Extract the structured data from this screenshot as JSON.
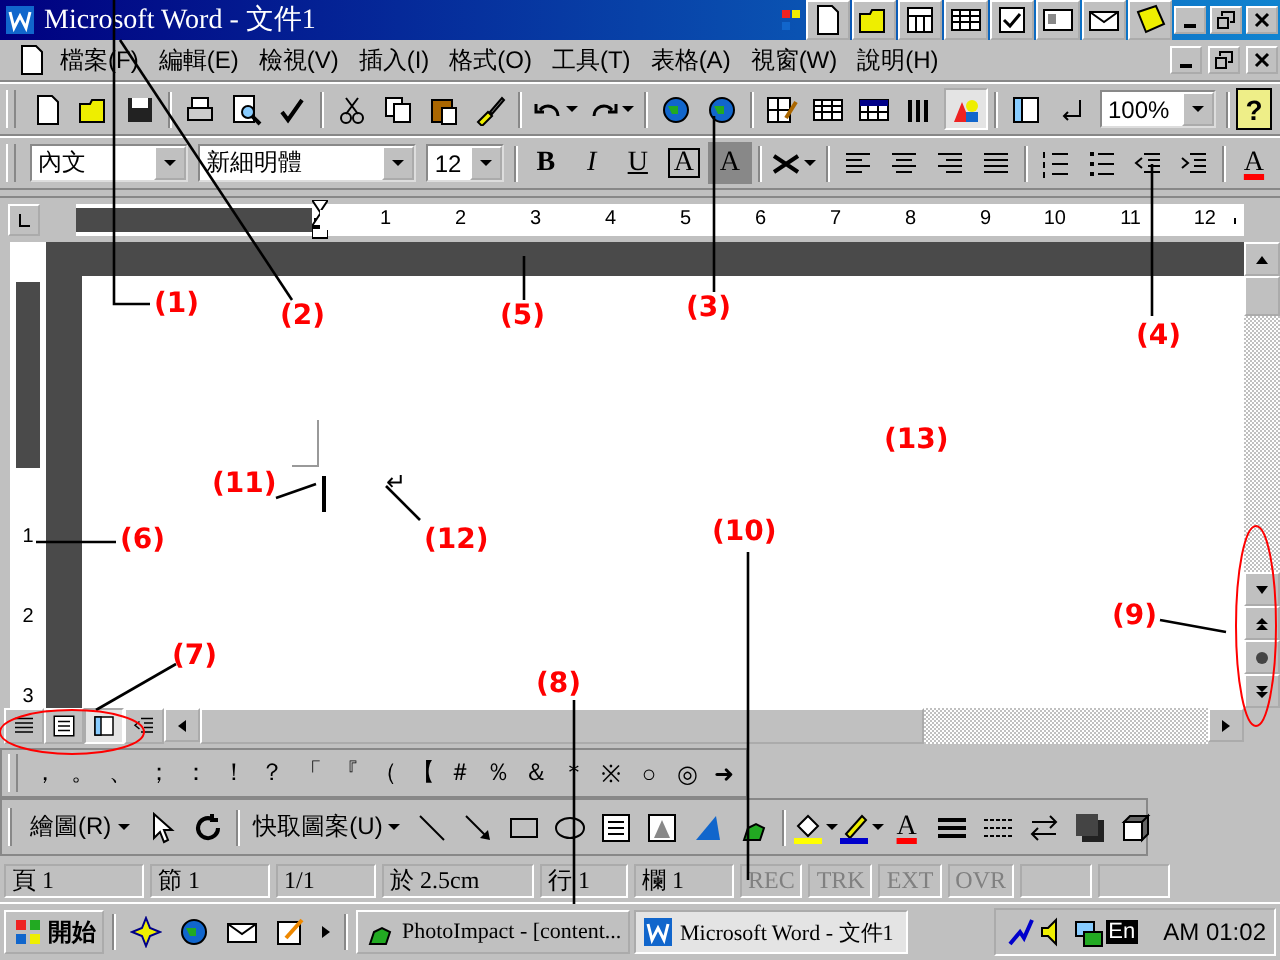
{
  "window": {
    "title": "Microsoft Word - 文件1"
  },
  "menu": [
    "檔案(F)",
    "編輯(E)",
    "檢視(V)",
    "插入(I)",
    "格式(O)",
    "工具(T)",
    "表格(A)",
    "視窗(W)",
    "說明(H)"
  ],
  "standard_toolbar": {
    "zoom": "100%",
    "help": "?",
    "drawing_button": {
      "pressed": true
    }
  },
  "formatting_toolbar": {
    "style": "內文",
    "font": "新細明體",
    "size": "12",
    "bold": "B",
    "italic": "I",
    "underline": "U",
    "border": "A",
    "shading": "A",
    "font_color": "A"
  },
  "ruler": {
    "marks": [
      "1",
      "2",
      "3",
      "4",
      "5",
      "6",
      "7",
      "8",
      "9",
      "10",
      "11",
      "12"
    ],
    "vertical_marks": [
      "1",
      "2",
      "3"
    ]
  },
  "document": {
    "paragraph_mark": "↵"
  },
  "annotations": [
    "(1)",
    "(2)",
    "(3)",
    "(4)",
    "(5)",
    "(6)",
    "(7)",
    "(8)",
    "(9)",
    "(10)",
    "(11)",
    "(12)",
    "(13)"
  ],
  "view_buttons": [
    {
      "selected": false
    },
    {
      "selected": false
    },
    {
      "selected": true
    },
    {
      "selected": false
    }
  ],
  "symbol_toolbar": [
    "，",
    "。",
    "、",
    "；",
    "：",
    "！",
    "？",
    "「",
    "『",
    "（",
    "【",
    "＃",
    "％",
    "＆",
    "＊",
    "※",
    "○",
    "◎",
    "➜"
  ],
  "drawing_toolbar": {
    "draw": "繪圖(R)",
    "autoshapes": "快取圖案(U)",
    "font_color": "A"
  },
  "status_bar": {
    "page": "頁 1",
    "section": "節 1",
    "pages": "1/1",
    "position": "於 2.5cm",
    "line": "行 1",
    "column": "欄 1",
    "modes": [
      "REC",
      "TRK",
      "EXT",
      "OVR"
    ]
  },
  "taskbar": {
    "start": "開始",
    "tasks": [
      {
        "label": "PhotoImpact - [content...",
        "selected": false
      },
      {
        "label": "Microsoft Word - 文件1",
        "selected": true
      }
    ],
    "language": "En",
    "clock": "AM 01:02"
  }
}
